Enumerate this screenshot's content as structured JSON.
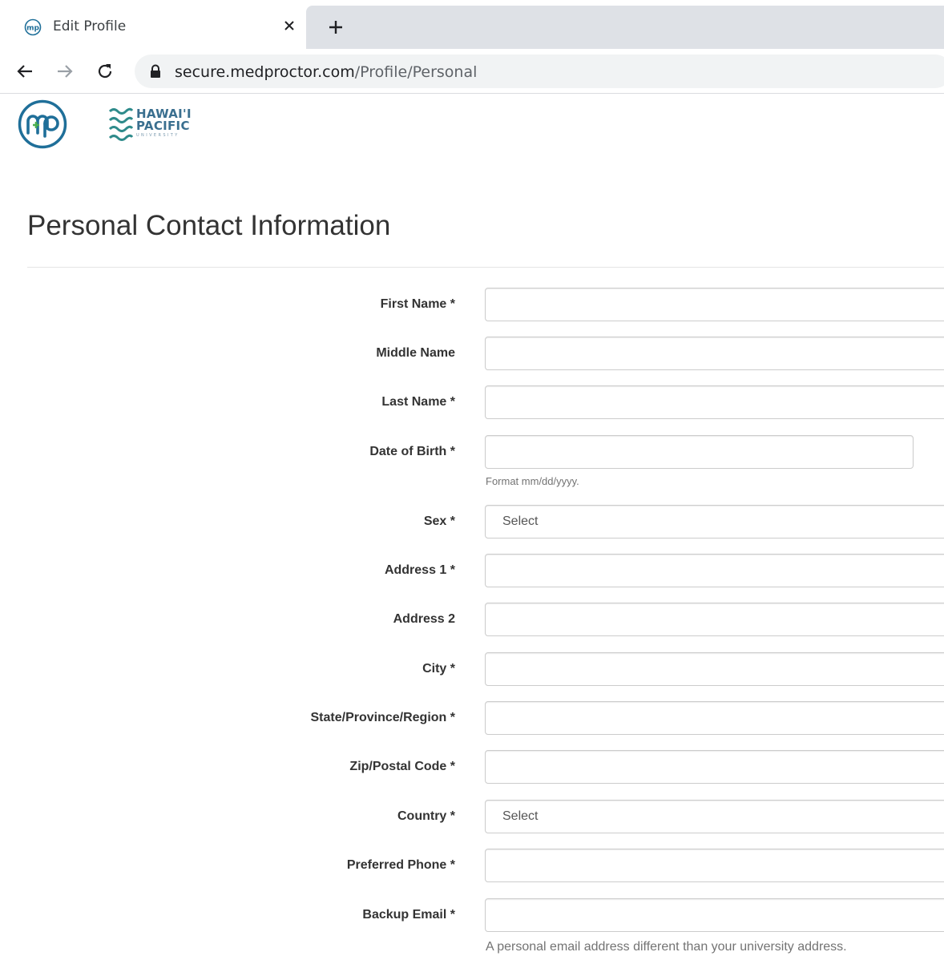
{
  "browser": {
    "tab_title": "Edit Profile",
    "url_domain": "secure.medproctor.com",
    "url_path": "/Profile/Personal"
  },
  "header": {
    "hpu_line1": "HAWAI'I",
    "hpu_line2": "PACIFIC",
    "hpu_line3": "UNIVERSITY"
  },
  "page": {
    "title": "Personal Contact Information"
  },
  "form": {
    "first_name": {
      "label": "First Name *",
      "value": ""
    },
    "middle_name": {
      "label": "Middle Name",
      "value": ""
    },
    "last_name": {
      "label": "Last Name *",
      "value": ""
    },
    "dob": {
      "label": "Date of Birth *",
      "value": "",
      "help": "Format mm/dd/yyyy."
    },
    "sex": {
      "label": "Sex *",
      "selected": "Select"
    },
    "address1": {
      "label": "Address 1 *",
      "value": ""
    },
    "address2": {
      "label": "Address 2",
      "value": ""
    },
    "city": {
      "label": "City *",
      "value": ""
    },
    "state": {
      "label": "State/Province/Region *",
      "value": ""
    },
    "zip": {
      "label": "Zip/Postal Code *",
      "value": ""
    },
    "country": {
      "label": "Country *",
      "selected": "Select"
    },
    "phone": {
      "label": "Preferred Phone *",
      "value": ""
    },
    "backup_email": {
      "label": "Backup Email *",
      "value": "",
      "help": "A personal email address different than your university address."
    }
  },
  "colors": {
    "brand_blue": "#1f6f99",
    "brand_green": "#4caf50",
    "hpu_blue": "#3a6f8f"
  }
}
